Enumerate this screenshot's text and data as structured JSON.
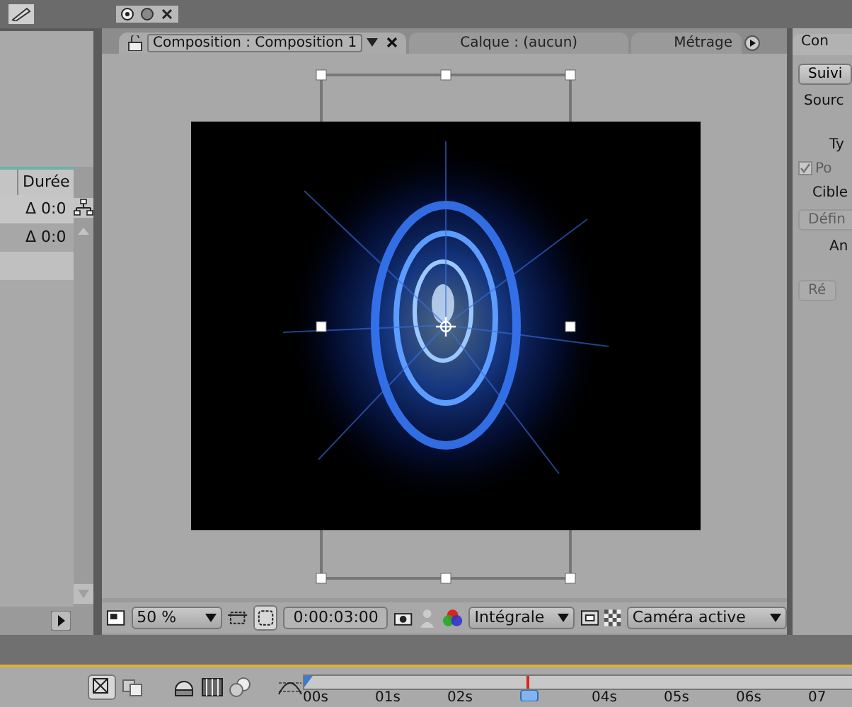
{
  "project_panel": {
    "columns": [
      "Durée"
    ],
    "rows": [
      {
        "duration": "Δ 0:0"
      },
      {
        "duration": "Δ 0:0"
      }
    ]
  },
  "viewer": {
    "tabs": [
      {
        "label": "Composition : Composition 1",
        "selected": true
      },
      {
        "label": "Calque : (aucun)",
        "selected": false
      },
      {
        "label": "Métrage",
        "selected": false
      }
    ],
    "toolbar": {
      "magnification": "50 %",
      "timecode": "0:00:03:00",
      "resolution": "Intégrale",
      "camera": "Caméra active"
    }
  },
  "right_panel": {
    "tab": "Con",
    "items": [
      {
        "kind": "button",
        "label": "Suivi",
        "disabled": false
      },
      {
        "kind": "label",
        "label": "Sourc"
      },
      {
        "kind": "label",
        "label": "Ty"
      },
      {
        "kind": "checkbox",
        "label": "Po",
        "checked": true,
        "disabled": true
      },
      {
        "kind": "label",
        "label": "Cible"
      },
      {
        "kind": "button",
        "label": "Défin",
        "disabled": true
      },
      {
        "kind": "label",
        "label": "An"
      },
      {
        "kind": "button",
        "label": "Ré",
        "disabled": true
      }
    ]
  },
  "timeline": {
    "ruler": [
      "00s",
      "01s",
      "02s",
      "04s",
      "05s",
      "06s",
      "07"
    ]
  }
}
